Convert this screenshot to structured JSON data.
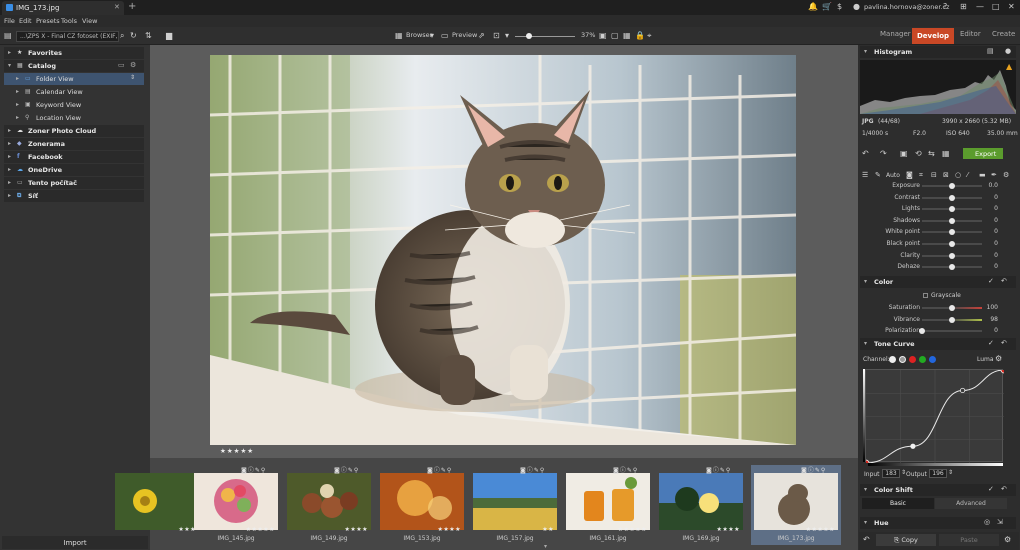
{
  "window": {
    "tab_title": "IMG_173.jpg",
    "user_email": "pavlina.hornova@zoner.cz"
  },
  "menu": [
    "File",
    "Edit",
    "Presets",
    "Tools",
    "View"
  ],
  "toolbar": {
    "path": "...\\ZPS X - Final CZ fotoset (EXIF, ord",
    "browser_label": "Browser",
    "preview_label": "Preview",
    "zoom": "37%",
    "modes": {
      "manager": "Manager",
      "develop": "Develop",
      "editor": "Editor",
      "create": "Create"
    }
  },
  "sidebar": {
    "items": [
      {
        "label": "Favorites",
        "level": 0,
        "bold": true,
        "header": true,
        "icon": "star-icon"
      },
      {
        "label": "Catalog",
        "level": 0,
        "bold": true,
        "header": true,
        "icon": "catalog-icon"
      },
      {
        "label": "Folder View",
        "level": 1,
        "bold": false,
        "selected": true,
        "icon": "folder-icon"
      },
      {
        "label": "Calendar View",
        "level": 1,
        "bold": false,
        "icon": "calendar-icon"
      },
      {
        "label": "Keyword View",
        "level": 1,
        "bold": false,
        "icon": "keyword-icon"
      },
      {
        "label": "Location View",
        "level": 1,
        "bold": false,
        "icon": "location-icon"
      },
      {
        "label": "Zoner Photo Cloud",
        "level": 0,
        "bold": true,
        "header": true,
        "icon": "cloud-icon"
      },
      {
        "label": "Zonerama",
        "level": 0,
        "bold": true,
        "header": true,
        "icon": "zonerama-icon"
      },
      {
        "label": "Facebook",
        "level": 0,
        "bold": true,
        "header": true,
        "icon": "facebook-icon"
      },
      {
        "label": "OneDrive",
        "level": 0,
        "bold": true,
        "header": true,
        "icon": "onedrive-icon"
      },
      {
        "label": "Tento počítač",
        "level": 0,
        "bold": true,
        "header": true,
        "icon": "computer-icon"
      },
      {
        "label": "Síť",
        "level": 0,
        "bold": true,
        "header": true,
        "icon": "network-icon"
      }
    ],
    "import_label": "Import"
  },
  "main_photo": {
    "rating": "★★★★★"
  },
  "filmstrip": [
    {
      "name": "",
      "stars": "★★★",
      "img": "yellow-flower"
    },
    {
      "name": "IMG_145.jpg",
      "stars": "★★★★★",
      "img": "bouquet"
    },
    {
      "name": "IMG_149.jpg",
      "stars": "★★★★",
      "img": "chestnuts"
    },
    {
      "name": "IMG_153.jpg",
      "stars": "★★★★",
      "img": "lights"
    },
    {
      "name": "IMG_157.jpg",
      "stars": "★★",
      "img": "landscape"
    },
    {
      "name": "IMG_161.jpg",
      "stars": "★★★★★",
      "img": "jars"
    },
    {
      "name": "IMG_169.jpg",
      "stars": "★★★★",
      "img": "sunset"
    },
    {
      "name": "IMG_173.jpg",
      "stars": "★★★★★",
      "img": "cat",
      "selected": true
    }
  ],
  "histogram": {
    "title": "Histogram"
  },
  "info": {
    "format": "JPG",
    "index": "(44/68)",
    "dimensions": "3990 x 2660 (5.32 MB)",
    "shutter": "1/4000 s",
    "aperture": "F2.0",
    "iso": "ISO 640",
    "focal": "35.00 mm"
  },
  "export_label": "Export",
  "auto_label": "Auto",
  "basic_adjustments": [
    {
      "label": "Exposure",
      "value": "0.0",
      "pos": 0.5
    },
    {
      "label": "Contrast",
      "value": "0",
      "pos": 0.5
    },
    {
      "label": "Lights",
      "value": "0",
      "pos": 0.5
    },
    {
      "label": "Shadows",
      "value": "0",
      "pos": 0.5
    },
    {
      "label": "White point",
      "value": "0",
      "pos": 0.5
    },
    {
      "label": "Black point",
      "value": "0",
      "pos": 0.5
    },
    {
      "label": "Clarity",
      "value": "0",
      "pos": 0.5
    },
    {
      "label": "Dehaze",
      "value": "0",
      "pos": 0.5
    }
  ],
  "color": {
    "title": "Color",
    "grayscale_label": "Grayscale",
    "sliders": [
      {
        "label": "Saturation",
        "value": "100",
        "pos": 0.5
      },
      {
        "label": "Vibrance",
        "value": "98",
        "pos": 0.5
      },
      {
        "label": "Polarization",
        "value": "0",
        "pos": 0.0
      }
    ]
  },
  "tone_curve": {
    "title": "Tone Curve",
    "channel_label": "Channel:",
    "luma_label": "Luma",
    "input_label": "Input",
    "input_value": "183",
    "output_label": "Output",
    "output_value": "196",
    "points": [
      [
        0,
        0
      ],
      [
        0.34,
        0.18
      ],
      [
        0.7,
        0.78
      ],
      [
        1,
        1
      ]
    ]
  },
  "color_shift": {
    "title": "Color Shift",
    "basic_label": "Basic",
    "advanced_label": "Advanced"
  },
  "hue": {
    "title": "Hue"
  },
  "bottom": {
    "copy_label": "Copy",
    "paste_label": "Paste"
  }
}
